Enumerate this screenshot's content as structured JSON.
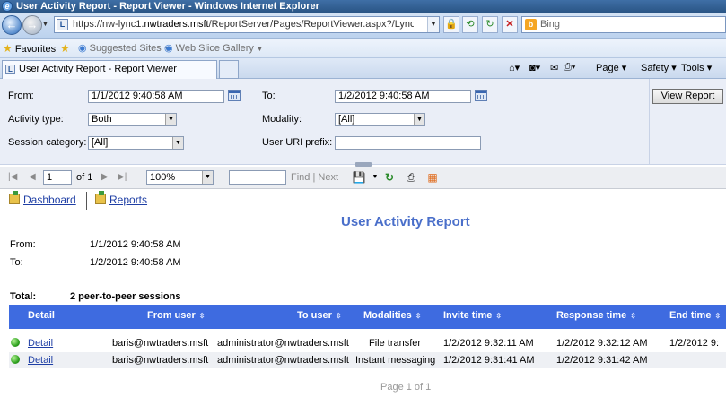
{
  "window": {
    "title": "User Activity Report - Report Viewer - Windows Internet Explorer"
  },
  "browser": {
    "url_prefix": "https://nw-lync1.",
    "url_domain": "nwtraders.msft",
    "url_path": "/ReportServer/Pages/ReportViewer.aspx?/LyncServerReports/Repor",
    "search_placeholder": "Bing",
    "favorites_label": "Favorites",
    "fav_suggested": "Suggested Sites",
    "fav_webslice": "Web Slice Gallery",
    "tab_title": "User Activity Report - Report Viewer",
    "cmd_page": "Page",
    "cmd_safety": "Safety",
    "cmd_tools": "Tools"
  },
  "params": {
    "from_label": "From:",
    "from_value": "1/1/2012 9:40:58 AM",
    "to_label": "To:",
    "to_value": "1/2/2012 9:40:58 AM",
    "activity_label": "Activity type:",
    "activity_value": "Both",
    "modality_label": "Modality:",
    "modality_value": "[All]",
    "session_label": "Session category:",
    "session_value": "[All]",
    "uri_label": "User URI prefix:",
    "uri_value": "",
    "view_report": "View Report"
  },
  "toolbar": {
    "page": "1",
    "of": "of 1",
    "zoom": "100%",
    "find": "Find",
    "sep": "|",
    "next": "Next"
  },
  "report": {
    "link_dashboard": "Dashboard",
    "link_reports": "Reports",
    "title": "User Activity Report",
    "from_label": "From:",
    "from_value": "1/1/2012 9:40:58 AM",
    "to_label": "To:",
    "to_value": "1/2/2012 9:40:58 AM",
    "total_label": "Total:",
    "total_value": "2 peer-to-peer sessions",
    "columns": [
      "Detail",
      "From user",
      "To user",
      "Modalities",
      "Invite time",
      "Response time",
      "End time"
    ],
    "rows": [
      {
        "detail": "Detail",
        "from": "baris@nwtraders.msft",
        "to": "administrator@nwtraders.msft",
        "modality": "File transfer",
        "invite": "1/2/2012 9:32:11 AM",
        "response": "1/2/2012 9:32:12 AM",
        "end": "1/2/2012 9:"
      },
      {
        "detail": "Detail",
        "from": "baris@nwtraders.msft",
        "to": "administrator@nwtraders.msft",
        "modality": "Instant messaging",
        "invite": "1/2/2012 9:31:41 AM",
        "response": "1/2/2012 9:31:42 AM",
        "end": ""
      }
    ],
    "footer": "Page 1 of 1"
  }
}
